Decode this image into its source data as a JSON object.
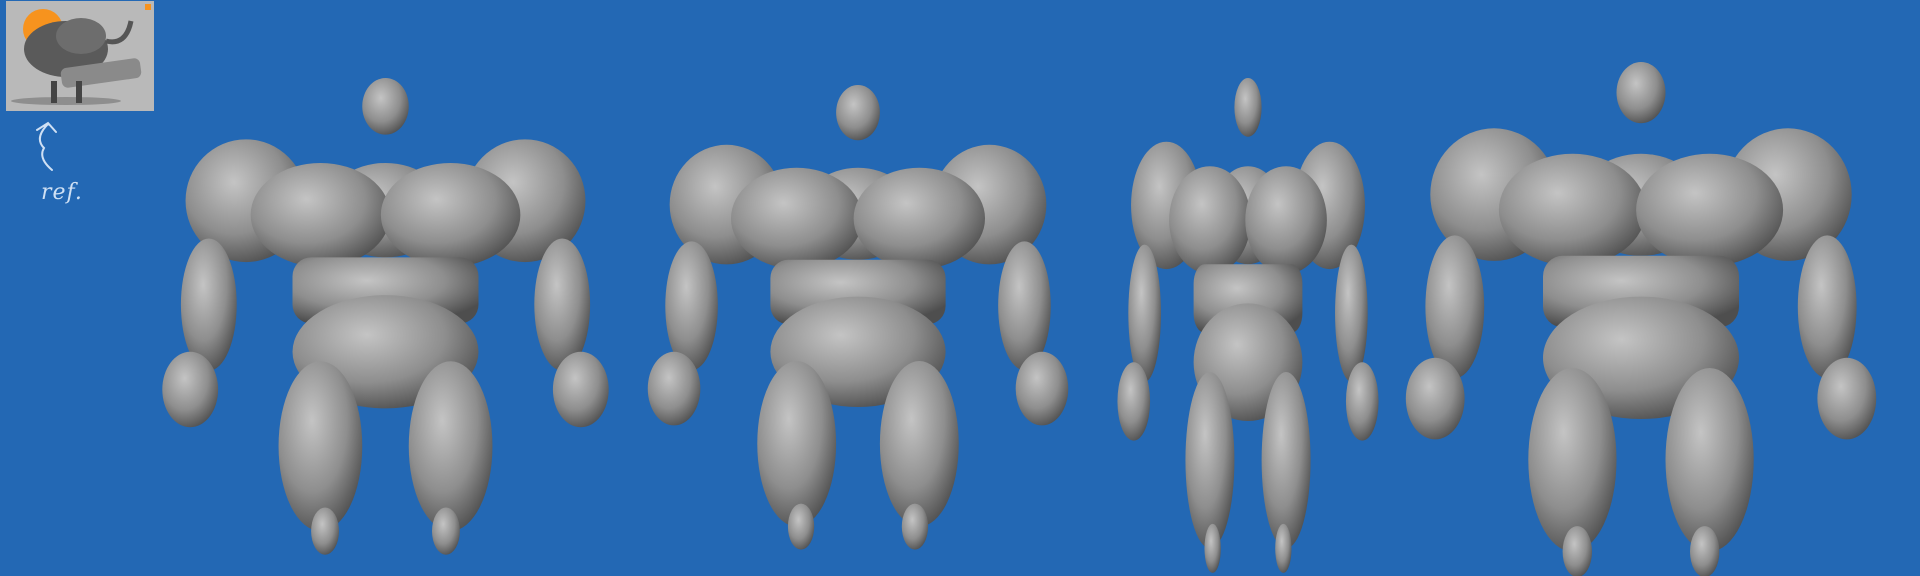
{
  "annotation": {
    "label": "ref."
  },
  "colors": {
    "background": "#2368b4",
    "sculpt": "#9a9a9a",
    "reference_sun": "#f7931e",
    "reference_bg": "#b9b9b9"
  },
  "views": [
    "front",
    "front-angled",
    "three-quarter",
    "back"
  ]
}
